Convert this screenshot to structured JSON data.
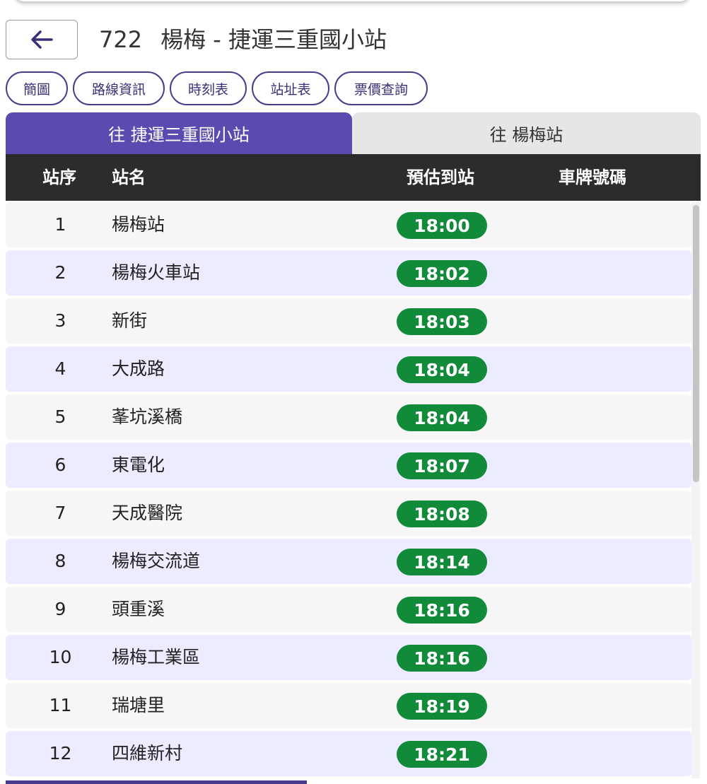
{
  "header": {
    "route_number": "722",
    "route_name": "楊梅 - 捷運三重國小站"
  },
  "icons": {
    "back": "arrow-left-icon"
  },
  "nav_pills": [
    "簡圖",
    "路線資訊",
    "時刻表",
    "站址表",
    "票價查詢"
  ],
  "direction_tabs": {
    "active": "往 捷運三重國小站",
    "inactive": "往 楊梅站"
  },
  "table": {
    "headers": {
      "seq": "站序",
      "name": "站名",
      "eta": "預估到站",
      "plate": "車牌號碼"
    },
    "rows": [
      {
        "seq": "1",
        "name": "楊梅站",
        "eta": "18:00",
        "plate": ""
      },
      {
        "seq": "2",
        "name": "楊梅火車站",
        "eta": "18:02",
        "plate": ""
      },
      {
        "seq": "3",
        "name": "新街",
        "eta": "18:03",
        "plate": ""
      },
      {
        "seq": "4",
        "name": "大成路",
        "eta": "18:04",
        "plate": ""
      },
      {
        "seq": "5",
        "name": "莑坑溪橋",
        "eta": "18:04",
        "plate": ""
      },
      {
        "seq": "6",
        "name": "東電化",
        "eta": "18:07",
        "plate": ""
      },
      {
        "seq": "7",
        "name": "天成醫院",
        "eta": "18:08",
        "plate": ""
      },
      {
        "seq": "8",
        "name": "楊梅交流道",
        "eta": "18:14",
        "plate": ""
      },
      {
        "seq": "9",
        "name": "頭重溪",
        "eta": "18:16",
        "plate": ""
      },
      {
        "seq": "10",
        "name": "楊梅工業區",
        "eta": "18:16",
        "plate": ""
      },
      {
        "seq": "11",
        "name": "瑞塘里",
        "eta": "18:19",
        "plate": ""
      },
      {
        "seq": "12",
        "name": "四維新村",
        "eta": "18:21",
        "plate": ""
      }
    ]
  },
  "colors": {
    "accent": "#5b4bb0",
    "pill_border": "#4a3a8c",
    "eta_badge": "#118a3a",
    "header_bg": "#2c2c2c",
    "row_alt": "#ecebff"
  }
}
